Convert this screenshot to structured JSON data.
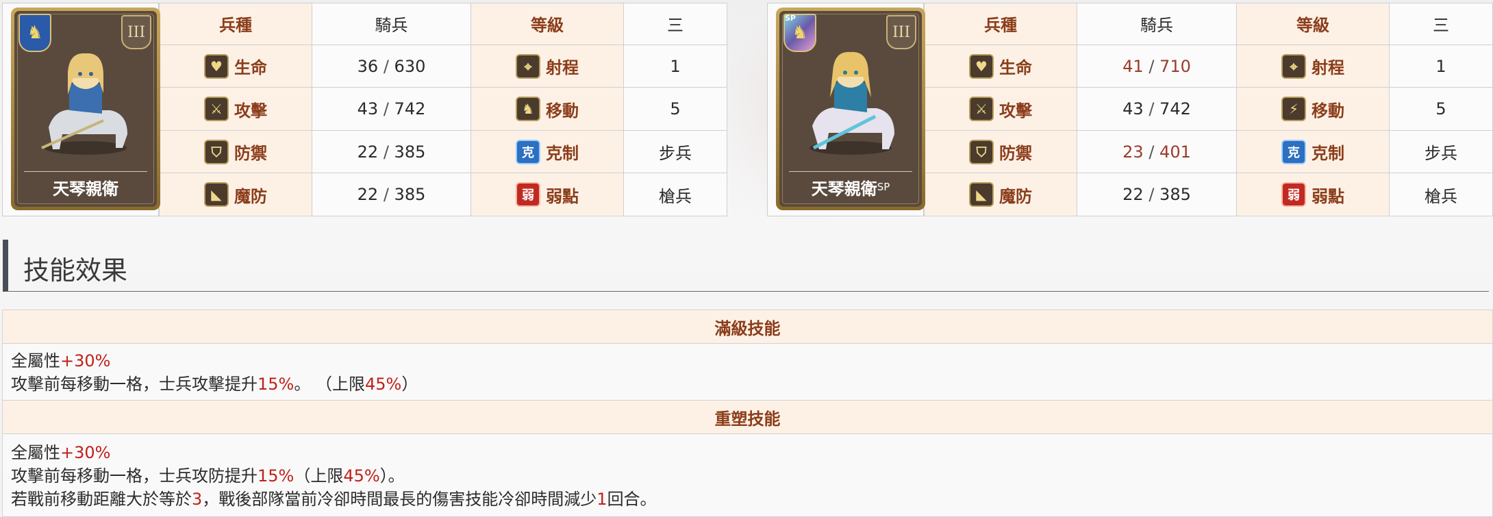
{
  "unit_a": {
    "name": "天琴親衛",
    "name_sup": "",
    "rank": "III",
    "table": {
      "type_label": "兵種",
      "type_value": "騎兵",
      "level_label": "等級",
      "level_value": "三",
      "hp_label": "生命",
      "hp_base": "36",
      "hp_max": "630",
      "range_label": "射程",
      "range_value": "1",
      "atk_label": "攻擊",
      "atk_base": "43",
      "atk_max": "742",
      "move_label": "移動",
      "move_value": "5",
      "def_label": "防禦",
      "def_base": "22",
      "def_max": "385",
      "counter_label": "克制",
      "counter_value": "步兵",
      "counter_icon": "克",
      "mdef_label": "魔防",
      "mdef_base": "22",
      "mdef_max": "385",
      "weak_label": "弱點",
      "weak_value": "槍兵",
      "weak_icon": "弱"
    }
  },
  "unit_b": {
    "name": "天琴親衛",
    "name_sup": "SP",
    "sp_badge": "SP",
    "rank": "III",
    "table": {
      "type_label": "兵種",
      "type_value": "騎兵",
      "level_label": "等級",
      "level_value": "三",
      "hp_label": "生命",
      "hp_base": "41",
      "hp_max": "710",
      "range_label": "射程",
      "range_value": "1",
      "atk_label": "攻擊",
      "atk_base": "43",
      "atk_max": "742",
      "move_label": "移動",
      "move_value": "5",
      "def_label": "防禦",
      "def_base": "23",
      "def_max": "401",
      "counter_label": "克制",
      "counter_value": "步兵",
      "counter_icon": "克",
      "mdef_label": "魔防",
      "mdef_base": "22",
      "mdef_max": "385",
      "weak_label": "弱點",
      "weak_value": "槍兵",
      "weak_icon": "弱"
    }
  },
  "separator": "/",
  "section_title": "技能效果",
  "skills": {
    "max_header": "滿級技能",
    "max_line1_text": "全屬性",
    "max_line1_val": "+30%",
    "max_line2_a": "攻擊前每移動一格，士兵攻擊提升",
    "max_line2_val1": "15%",
    "max_line2_b": "。 （上限",
    "max_line2_val2": "45%",
    "max_line2_c": "）",
    "remake_header": "重塑技能",
    "remake_line1_text": "全屬性",
    "remake_line1_val": "+30%",
    "remake_line2_a": "攻擊前每移動一格，士兵攻防提升",
    "remake_line2_val1": "15%",
    "remake_line2_b": "（上限",
    "remake_line2_val2": "45%",
    "remake_line2_c": "）。",
    "remake_line3_a": "若戰前移動距離大於等於",
    "remake_line3_val1": "3",
    "remake_line3_b": "，戰後部隊當前冷卻時間最長的傷害技能冷卻時間減少",
    "remake_line3_val2": "1",
    "remake_line3_c": "回合。"
  },
  "colors": {
    "header_bg": "#fdf1e6",
    "header_text": "#8b3d1a",
    "highlight_red": "#c0211a",
    "stat_up": "#9b3a2b"
  },
  "icons": [
    "horse-class-icon",
    "heart-icon",
    "sword-icon",
    "shield-icon",
    "boot-icon",
    "crosshair-icon",
    "horse-move-icon",
    "counter-icon",
    "weakness-icon"
  ]
}
